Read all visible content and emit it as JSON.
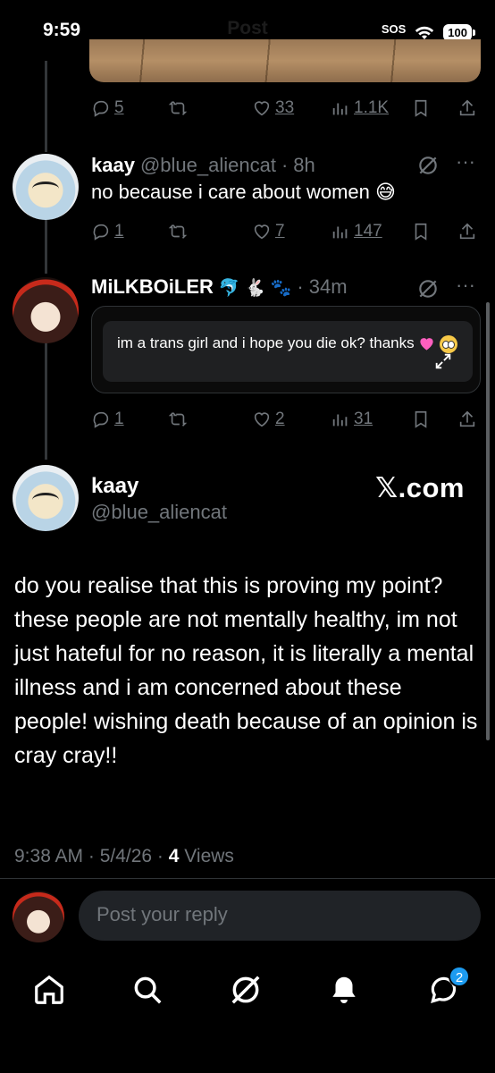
{
  "status_bar": {
    "time": "9:59",
    "title": "Post",
    "sos": "SOS",
    "battery": "100"
  },
  "tweets": [
    {
      "actions": {
        "replies": "5",
        "likes": "33",
        "views": "1.1K"
      }
    },
    {
      "name": "kaay",
      "handle": "@blue_aliencat",
      "time": "8h",
      "text": "no because i care about women 😅",
      "actions": {
        "replies": "1",
        "likes": "7",
        "views": "147"
      }
    },
    {
      "name": "MiLKBOiLER",
      "name_emojis": "🐬 🐇 🐾",
      "time": "34m",
      "quote_text": "im a trans girl and i hope you die ok? thanks",
      "actions": {
        "replies": "1",
        "likes": "2",
        "views": "31"
      }
    }
  ],
  "main_post": {
    "name": "kaay",
    "handle": "@blue_aliencat",
    "watermark": "𝕏.com",
    "text": "do you realise that this is proving my point? these people are not mentally healthy, im not just hateful for no reason, it is literally a mental illness and i am concerned about these people! wishing death because of an opinion is cray cray!!",
    "timestamp": "9:38 AM · 5/4/26 · ",
    "views_count": "4",
    "views_label": " Views"
  },
  "reply": {
    "placeholder": "Post your reply"
  },
  "nav": {
    "messages_badge": "2"
  },
  "colors": {
    "accent": "#1d9bf0",
    "muted": "#71767b",
    "background": "#000000"
  }
}
